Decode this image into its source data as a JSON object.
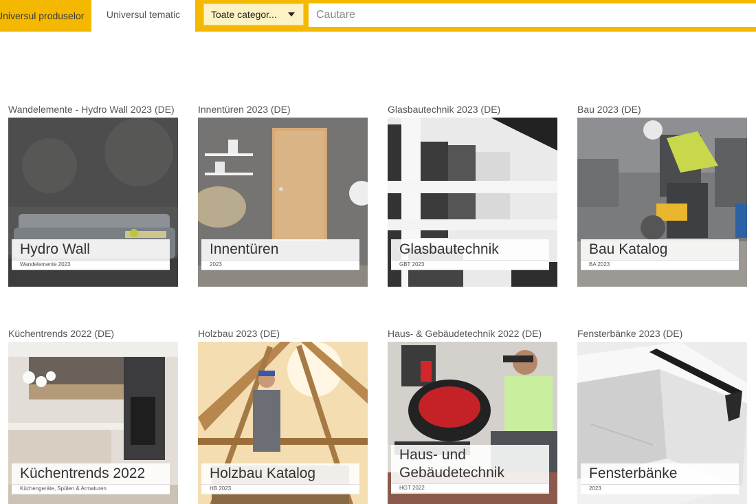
{
  "nav": {
    "products_tab": "Universul produselor",
    "thematic_tab": "Universul tematic"
  },
  "search": {
    "category_label": "Toate categor...",
    "placeholder": "Cautare"
  },
  "catalogs": [
    {
      "caption": "Wandelemente - Hydro Wall 2023 (DE)",
      "title": "Hydro Wall",
      "subtitle": "Wandelemente 2023"
    },
    {
      "caption": "Innentüren 2023 (DE)",
      "title": "Innentüren",
      "subtitle": "2023"
    },
    {
      "caption": "Glasbautechnik 2023 (DE)",
      "title": "Glasbautechnik",
      "subtitle": "GBT 2023"
    },
    {
      "caption": "Bau 2023 (DE)",
      "title": "Bau Katalog",
      "subtitle": "BA 2023"
    },
    {
      "caption": "Küchentrends 2022 (DE)",
      "title": "Küchentrends 2022",
      "subtitle": "Küchengeräte, Spülen & Armaturen"
    },
    {
      "caption": "Holzbau 2023 (DE)",
      "title": "Holzbau Katalog",
      "subtitle": "HB 2023"
    },
    {
      "caption": "Haus- & Gebäudetechnik 2022 (DE)",
      "title": "Haus- und Gebäudetechnik",
      "subtitle": "HGT 2022"
    },
    {
      "caption": "Fensterbänke 2023 (DE)",
      "title": "Fensterbänke",
      "subtitle": "2023"
    }
  ],
  "colors": {
    "accent": "#f5b800",
    "select_bg": "#fdf2c3"
  },
  "icons": {
    "dropdown": "caret-down-icon"
  }
}
